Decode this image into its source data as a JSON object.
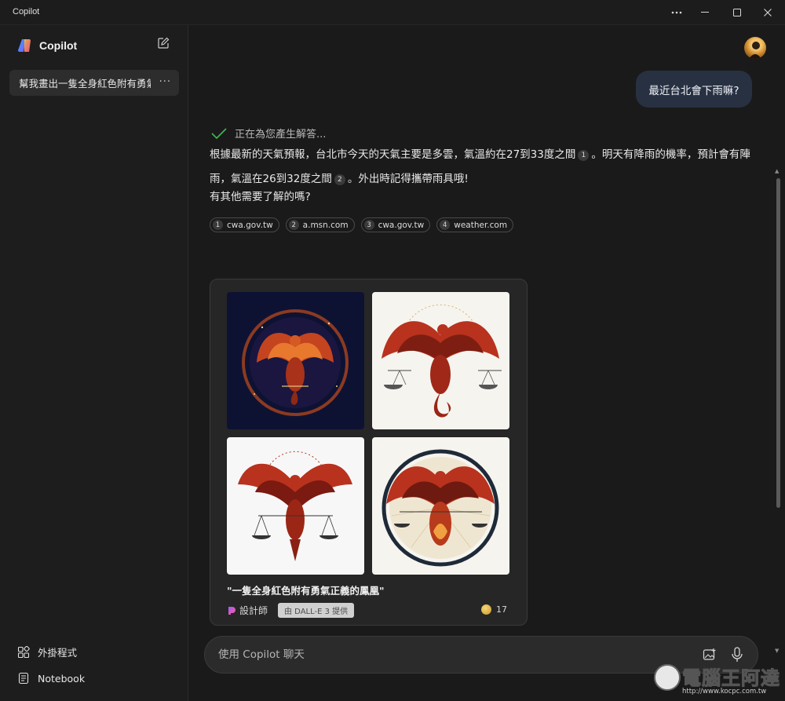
{
  "window": {
    "title": "Copilot",
    "controls": [
      "more-icon",
      "minimize-icon",
      "maximize-icon",
      "close-icon"
    ]
  },
  "sidebar": {
    "brand": "Copilot",
    "history": [
      {
        "label": "幫我畫出一隻全身紅色附有勇氣正義的鳳凰",
        "more": "···"
      }
    ],
    "footer": [
      {
        "label": "外掛程式",
        "icon": "plugins-icon"
      },
      {
        "label": "Notebook",
        "icon": "notebook-icon"
      }
    ]
  },
  "conversation": {
    "user_message": "最近台北會下雨嘛?",
    "status": "正在為您產生解答...",
    "answer": {
      "part1": "根據最新的天氣預報，台北市今天的天氣主要是多雲，氣溫約在27到33度之間",
      "cite1": "1",
      "part2": "。明天有降雨的機率，預計會有陣雨，氣溫在26到32度之間",
      "cite2": "2",
      "part3": "。外出時記得攜帶雨具哦!"
    },
    "followup": "有其他需要了解的嗎?",
    "sources": [
      {
        "num": "1",
        "label": "cwa.gov.tw"
      },
      {
        "num": "2",
        "label": "a.msn.com"
      },
      {
        "num": "3",
        "label": "cwa.gov.tw"
      },
      {
        "num": "4",
        "label": "weather.com"
      }
    ]
  },
  "image_card": {
    "caption": "\"一隻全身紅色附有勇氣正義的鳳凰\"",
    "designer": "設計師",
    "badge": "由 DALL-E 3 提供",
    "boosts": "17"
  },
  "input": {
    "placeholder": "使用 Copilot 聊天"
  },
  "watermark": {
    "text": "電腦王阿達",
    "url": "http://www.kocpc.com.tw"
  },
  "colors": {
    "background": "#1a1a1a",
    "sidebar": "#1d1d1d",
    "user_bubble": "#283142",
    "phoenix_red": "#b8321e",
    "check_green": "#3fb950"
  }
}
